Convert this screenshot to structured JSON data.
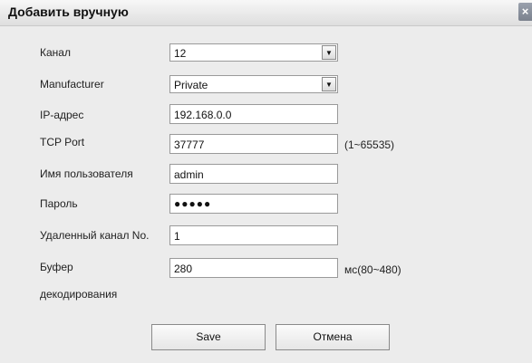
{
  "dialog": {
    "title": "Добавить вручную",
    "close_glyph": "×"
  },
  "form": {
    "channel": {
      "label": "Канал",
      "value": "12"
    },
    "manufacturer": {
      "label": "Manufacturer",
      "value": "Private"
    },
    "ip": {
      "label": "IP-адрес",
      "value": "192.168.0.0"
    },
    "tcp_port": {
      "label": "TCP Port",
      "value": "37777",
      "hint": "(1~65535)"
    },
    "username": {
      "label": "Имя пользователя",
      "value": "admin"
    },
    "password": {
      "label": "Пароль",
      "value": "●●●●●"
    },
    "remote_channel": {
      "label": "Удаленный канал No.",
      "value": "1"
    },
    "buffer": {
      "label_line1": "Буфер",
      "label_line2": "декодирования",
      "value": "280",
      "hint": "мс(80~480)"
    }
  },
  "buttons": {
    "save": "Save",
    "cancel": "Отмена"
  },
  "icons": {
    "dropdown_arrow": "▼"
  }
}
